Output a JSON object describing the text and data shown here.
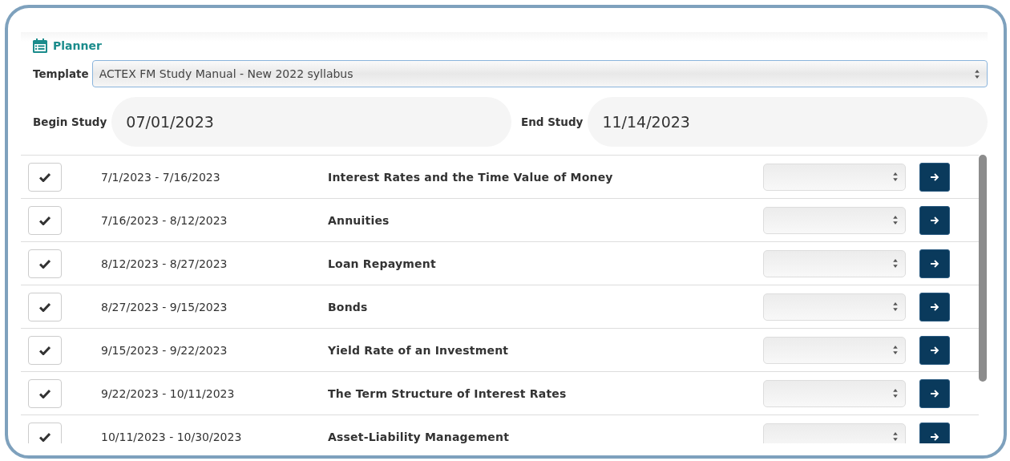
{
  "header": {
    "title": "Planner"
  },
  "template": {
    "label": "Template",
    "value": "ACTEX FM Study Manual - New 2022 syllabus"
  },
  "dates": [
    {
      "label": "Begin Study",
      "value": "07/01/2023"
    },
    {
      "label": "End Study",
      "value": "11/14/2023"
    }
  ],
  "schedule": [
    {
      "checked": true,
      "dates": "7/1/2023 - 7/16/2023",
      "topic": "Interest Rates and the Time Value of Money"
    },
    {
      "checked": true,
      "dates": "7/16/2023 - 8/12/2023",
      "topic": "Annuities"
    },
    {
      "checked": true,
      "dates": "8/12/2023 - 8/27/2023",
      "topic": "Loan Repayment"
    },
    {
      "checked": true,
      "dates": "8/27/2023 - 9/15/2023",
      "topic": "Bonds"
    },
    {
      "checked": true,
      "dates": "9/15/2023 - 9/22/2023",
      "topic": "Yield Rate of an Investment"
    },
    {
      "checked": true,
      "dates": "9/22/2023 - 10/11/2023",
      "topic": "The Term Structure of Interest Rates"
    },
    {
      "checked": true,
      "dates": "10/11/2023 - 10/30/2023",
      "topic": "Asset-Liability Management"
    }
  ]
}
